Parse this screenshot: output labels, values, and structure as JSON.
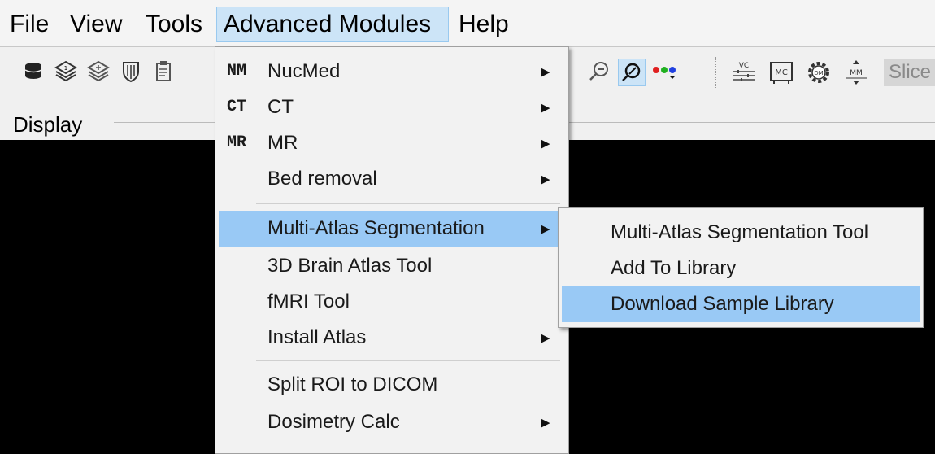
{
  "menubar": {
    "items": [
      {
        "label": "File"
      },
      {
        "label": "View"
      },
      {
        "label": "Tools"
      },
      {
        "label": "Advanced Modules"
      },
      {
        "label": "Help"
      }
    ]
  },
  "toolbar": {
    "left_icons": [
      "database-icon",
      "layers-1-icon",
      "layers-plus-icon",
      "shield-icon",
      "clipboard-icon"
    ],
    "right_icons": [
      "zoom-out-icon",
      "annotation-icon",
      "rgb-dots-icon",
      "vc-icon",
      "mc-icon",
      "gear-dm-icon",
      "mm-icon"
    ],
    "slice_label": "Slice",
    "glyphs": {
      "vc": "VC",
      "mc": "MC",
      "dm": "DM",
      "mm": "MM"
    }
  },
  "display": {
    "label": "Display"
  },
  "advanced_menu": {
    "items": [
      {
        "prefix": "NM",
        "label": "NucMed",
        "submenu": true
      },
      {
        "prefix": "CT",
        "label": "CT",
        "submenu": true
      },
      {
        "prefix": "MR",
        "label": "MR",
        "submenu": true
      },
      {
        "prefix": "",
        "label": "Bed removal",
        "submenu": true
      },
      {
        "prefix": "",
        "label": "Multi-Atlas Segmentation",
        "submenu": true,
        "highlighted": true
      },
      {
        "prefix": "",
        "label": "3D Brain Atlas Tool",
        "submenu": false
      },
      {
        "prefix": "",
        "label": "fMRI Tool",
        "submenu": false
      },
      {
        "prefix": "",
        "label": "Install Atlas",
        "submenu": true
      },
      {
        "prefix": "",
        "label": "Split ROI to DICOM",
        "submenu": false
      },
      {
        "prefix": "",
        "label": "Dosimetry Calc",
        "submenu": true
      }
    ]
  },
  "submenu": {
    "items": [
      {
        "label": "Multi-Atlas Segmentation Tool"
      },
      {
        "label": "Add To Library"
      },
      {
        "label": "Download Sample Library",
        "highlighted": true
      }
    ]
  },
  "colors": {
    "highlight": "#99c9f5",
    "menu_bg": "#f2f2f2",
    "viewport": "#000000"
  }
}
